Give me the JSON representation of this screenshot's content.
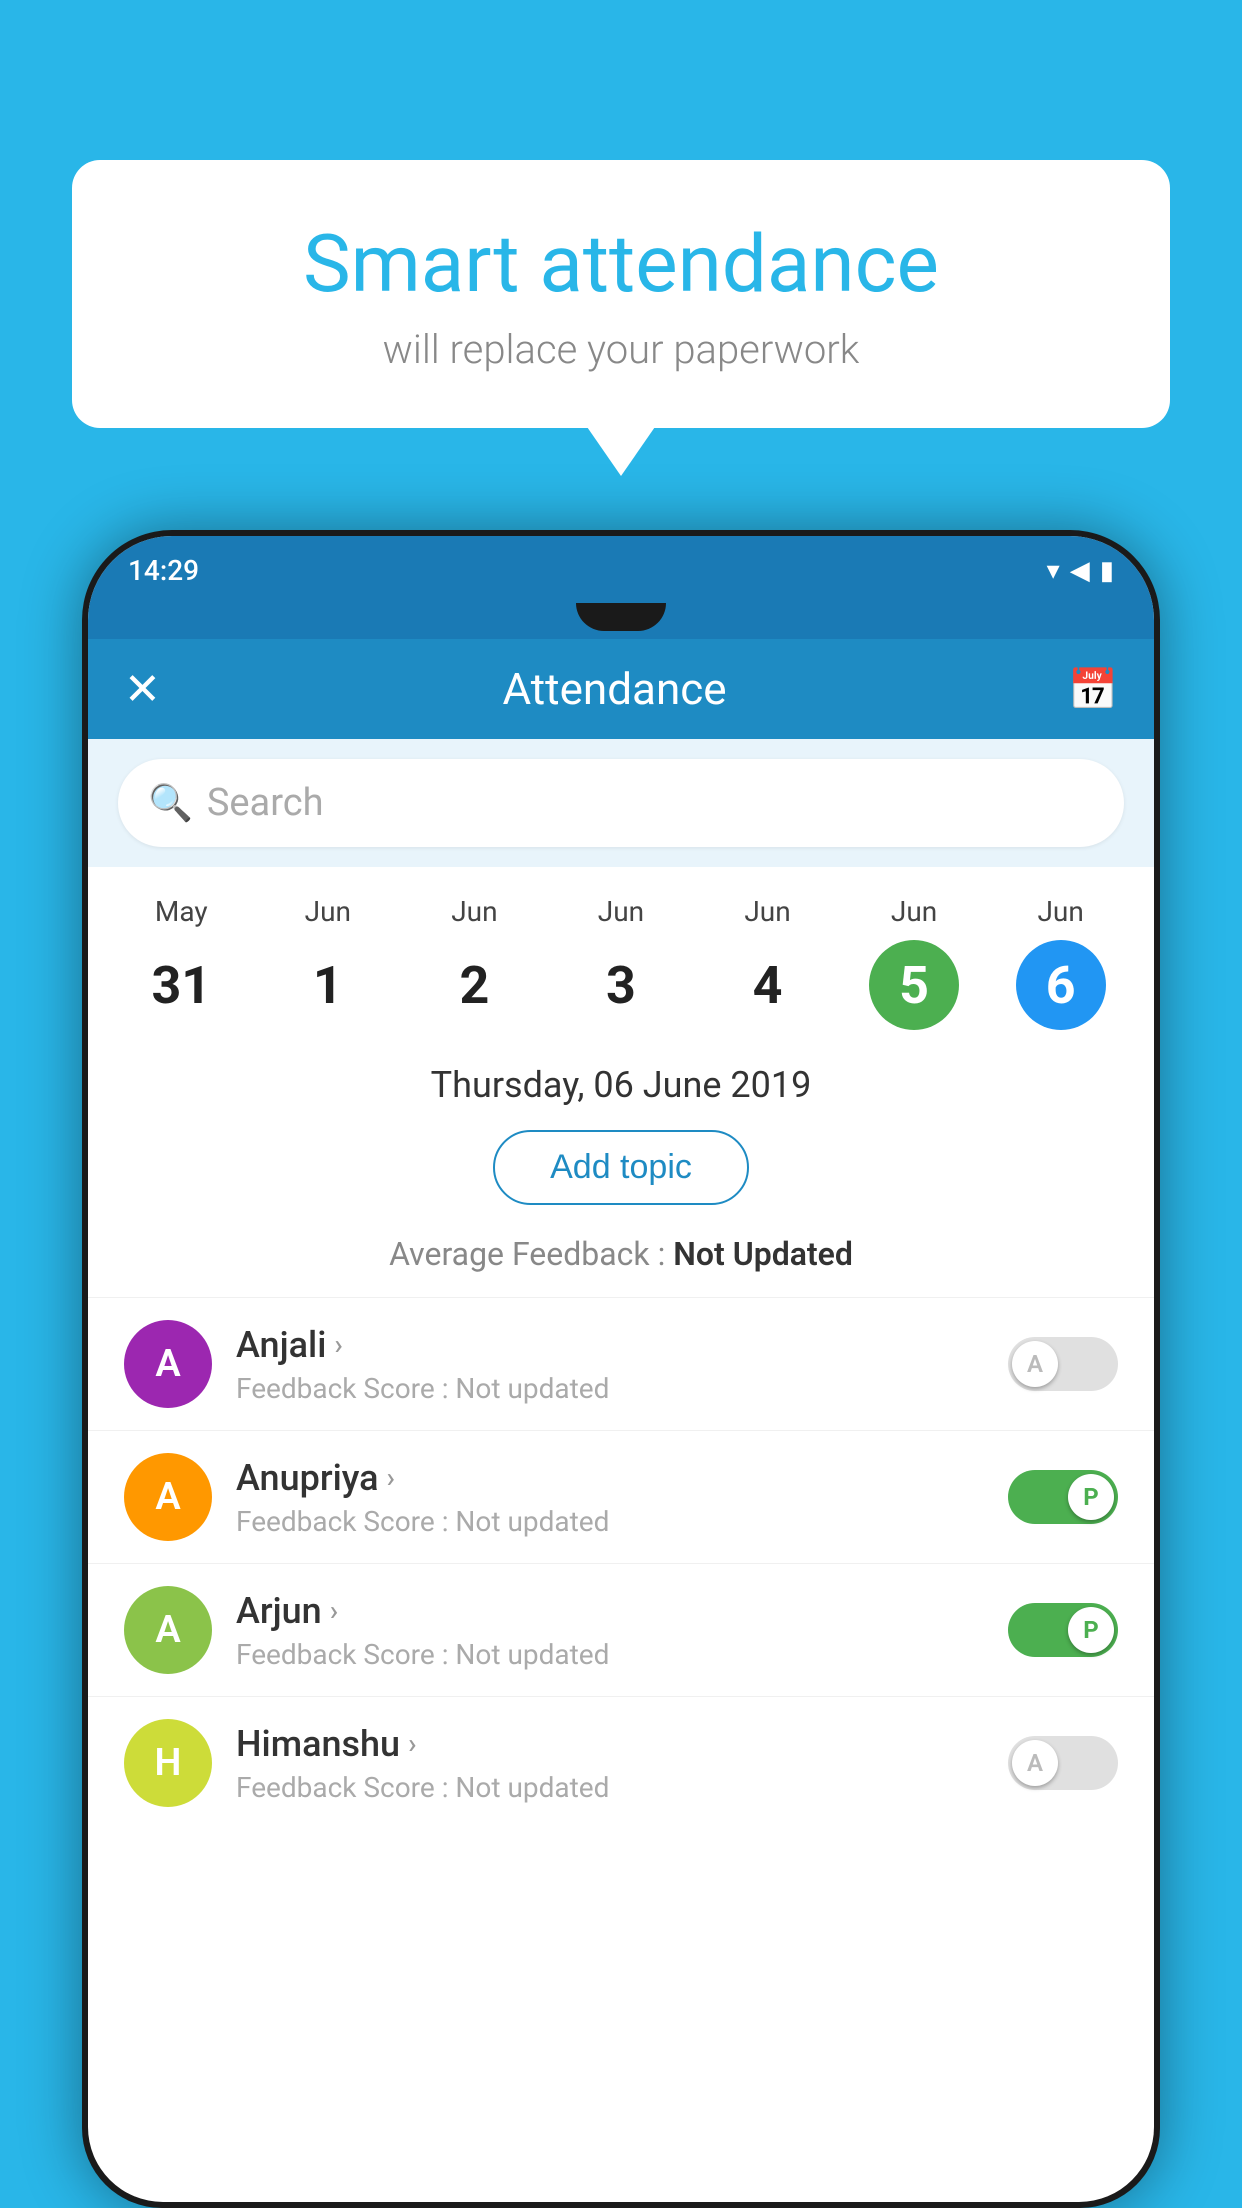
{
  "background_color": "#29B6E8",
  "bubble": {
    "title": "Smart attendance",
    "subtitle": "will replace your paperwork"
  },
  "status_bar": {
    "time": "14:29",
    "icons": "▲ ◀ ▮"
  },
  "app_header": {
    "title": "Attendance",
    "close_label": "✕",
    "calendar_icon": "📅"
  },
  "search": {
    "placeholder": "Search"
  },
  "calendar": {
    "days": [
      {
        "month": "May",
        "date": "31",
        "style": "normal"
      },
      {
        "month": "Jun",
        "date": "1",
        "style": "normal"
      },
      {
        "month": "Jun",
        "date": "2",
        "style": "normal"
      },
      {
        "month": "Jun",
        "date": "3",
        "style": "normal"
      },
      {
        "month": "Jun",
        "date": "4",
        "style": "normal"
      },
      {
        "month": "Jun",
        "date": "5",
        "style": "active-green"
      },
      {
        "month": "Jun",
        "date": "6",
        "style": "active-blue"
      }
    ]
  },
  "selected_date": "Thursday, 06 June 2019",
  "add_topic_label": "Add topic",
  "average_feedback_label": "Average Feedback :",
  "average_feedback_value": "Not Updated",
  "students": [
    {
      "name": "Anjali",
      "avatar_letter": "A",
      "avatar_color": "avatar-purple",
      "feedback_label": "Feedback Score : Not updated",
      "toggle": "off"
    },
    {
      "name": "Anupriya",
      "avatar_letter": "A",
      "avatar_color": "avatar-orange",
      "feedback_label": "Feedback Score : Not updated",
      "toggle": "on"
    },
    {
      "name": "Arjun",
      "avatar_letter": "A",
      "avatar_color": "avatar-green",
      "feedback_label": "Feedback Score : Not updated",
      "toggle": "on"
    },
    {
      "name": "Himanshu",
      "avatar_letter": "H",
      "avatar_color": "avatar-lime",
      "feedback_label": "Feedback Score : Not updated",
      "toggle": "off"
    }
  ]
}
